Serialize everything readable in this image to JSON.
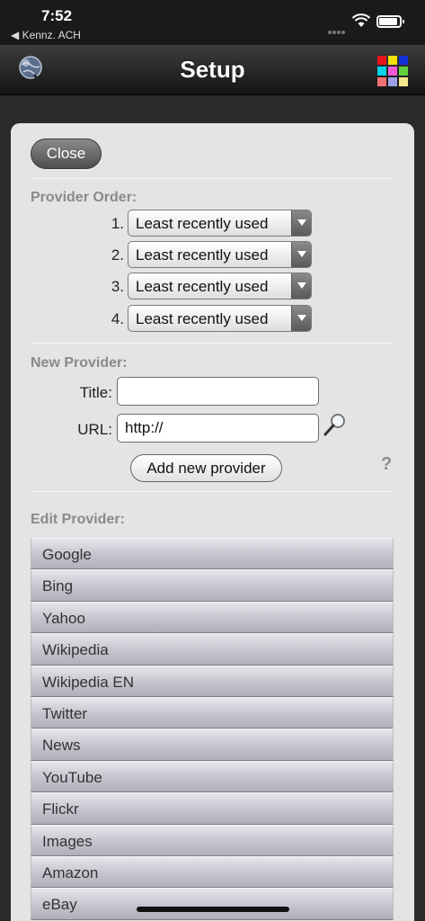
{
  "status_bar": {
    "time": "7:52",
    "back_app": "◀ Kennz. ACH"
  },
  "nav": {
    "title": "Setup",
    "left_icon": "globe-icon",
    "right_icon": "color-grid-icon"
  },
  "close_label": "Close",
  "provider_order": {
    "label": "Provider Order:",
    "rows": [
      {
        "number": "1.",
        "value": "Least recently used"
      },
      {
        "number": "2.",
        "value": "Least recently used"
      },
      {
        "number": "3.",
        "value": "Least recently used"
      },
      {
        "number": "4.",
        "value": "Least recently used"
      }
    ]
  },
  "new_provider": {
    "label": "New Provider:",
    "title_label": "Title:",
    "title_value": "",
    "url_label": "URL:",
    "url_value": "http://",
    "add_label": "Add new provider",
    "help": "?"
  },
  "edit_provider": {
    "label": "Edit Provider:",
    "items": [
      "Google",
      "Bing",
      "Yahoo",
      "Wikipedia",
      "Wikipedia EN",
      "Twitter",
      "News",
      "YouTube",
      "Flickr",
      "Images",
      "Amazon",
      "eBay"
    ]
  },
  "colors": {
    "grid": [
      "#e8141e",
      "#f5e20c",
      "#1430d8",
      "#00d4e6",
      "#f25ad8",
      "#62d23c",
      "#f27070",
      "#9da2e8",
      "#f2e88c"
    ]
  }
}
